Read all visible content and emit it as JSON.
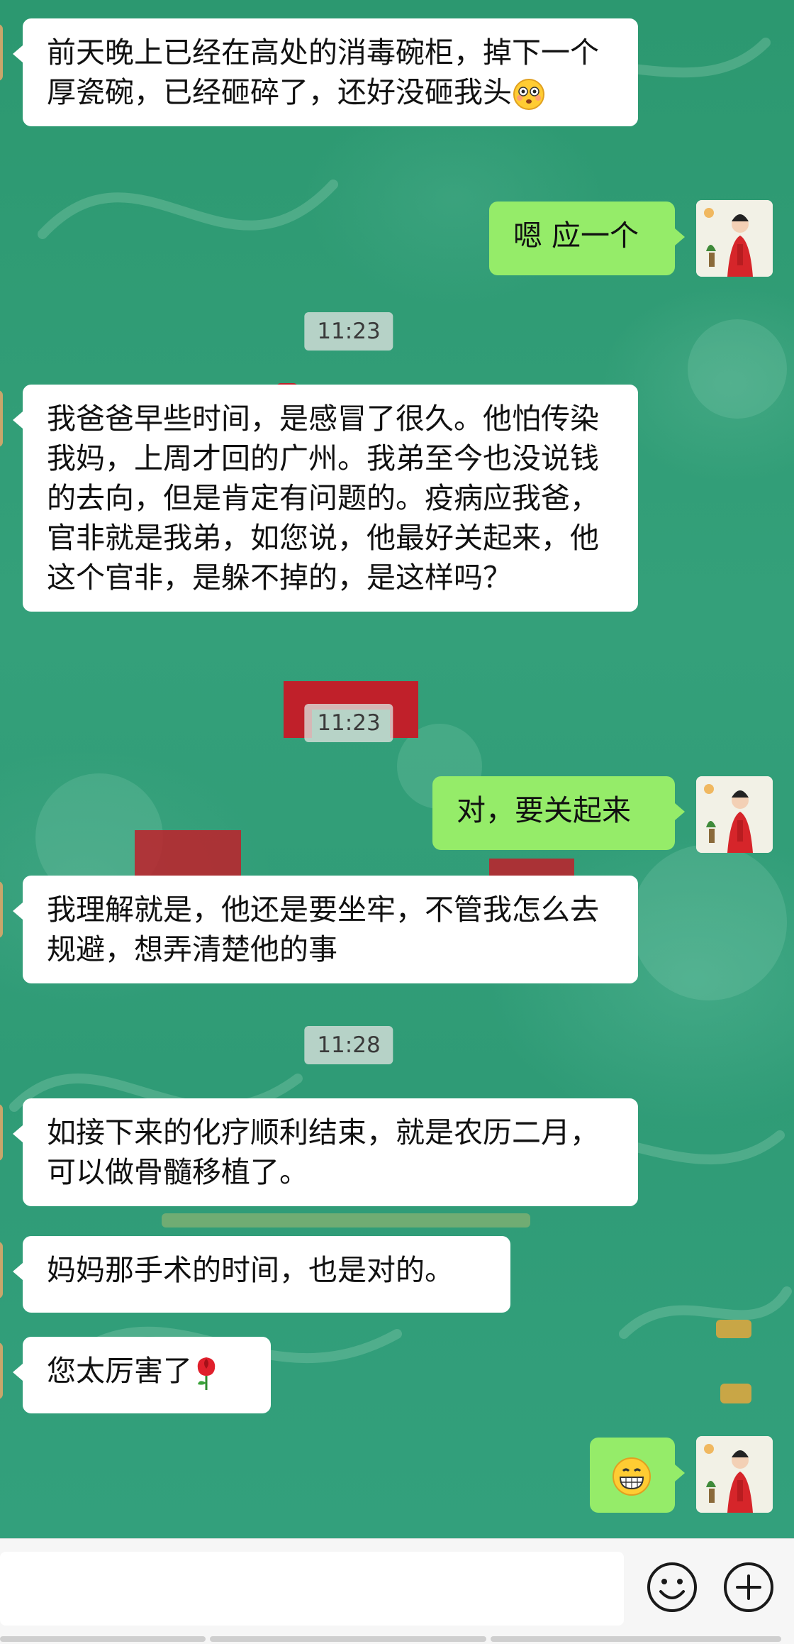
{
  "conversation": {
    "messages": [
      {
        "side": "in",
        "text": "前天晚上已经在高处的消毒碗柜，掉下一个厚瓷碗，已经砸碎了，还好没砸我头",
        "emoji": "flushed-face"
      },
      {
        "side": "out",
        "text": "嗯 应一个"
      },
      {
        "side": "in",
        "text": "我爸爸早些时间，是感冒了很久。他怕传染我妈，上周才回的广州。我弟至今也没说钱的去向，但是肯定有问题的。疫病应我爸，官非就是我弟，如您说，他最好关起来，他这个官非，是躲不掉的，是这样吗？"
      },
      {
        "side": "out",
        "text": "对，要关起来"
      },
      {
        "side": "in",
        "text": "我理解就是，他还是要坐牢，不管我怎么去规避，想弄清楚他的事"
      },
      {
        "side": "in",
        "text": "如接下来的化疗顺利结束，就是农历二月，可以做骨髓移植了。"
      },
      {
        "side": "in",
        "text": "妈妈那手术的时间，也是对的。"
      },
      {
        "side": "in",
        "text": "您太厉害了",
        "emoji": "rose"
      },
      {
        "side": "out",
        "text": "",
        "emoji": "grinning-face"
      }
    ],
    "timestamps": [
      "11:23",
      "11:23",
      "11:28"
    ]
  },
  "input_bar": {
    "placeholder": "",
    "value": "",
    "icons": [
      "emoji-face-icon",
      "plus-icon"
    ]
  },
  "colors": {
    "outgoing_bubble": "#95ec69",
    "incoming_bubble": "#ffffff",
    "wallpaper": "#2f9a74"
  }
}
